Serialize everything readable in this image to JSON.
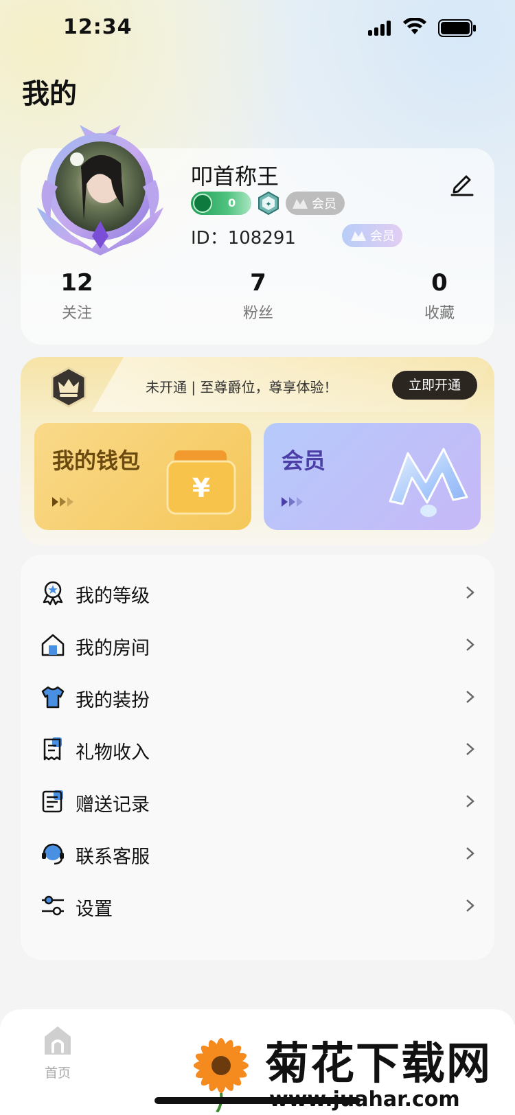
{
  "status_bar": {
    "time": "12:34"
  },
  "page": {
    "title": "我的"
  },
  "profile": {
    "nickname": "叩首称王",
    "level_value": "0",
    "vip_badge": "会员",
    "id_text": "ID：108291",
    "vip_badge_2": "会员",
    "stats": [
      {
        "value": "12",
        "label": "关注"
      },
      {
        "value": "7",
        "label": "粉丝"
      },
      {
        "value": "0",
        "label": "收藏"
      }
    ]
  },
  "vip_banner": {
    "promo_text": "未开通 | 至尊爵位，尊享体验！",
    "open_button": "立即开通"
  },
  "cards": {
    "wallet": {
      "title": "我的钱包",
      "icon_symbol": "¥"
    },
    "member": {
      "title": "会员"
    }
  },
  "menu": {
    "items": [
      {
        "label": "我的等级",
        "icon": "level-medal-icon"
      },
      {
        "label": "我的房间",
        "icon": "room-house-icon"
      },
      {
        "label": "我的装扮",
        "icon": "outfit-shirt-icon"
      },
      {
        "label": "礼物收入",
        "icon": "gift-income-receipt-icon"
      },
      {
        "label": "赠送记录",
        "icon": "gift-record-list-icon"
      },
      {
        "label": "联系客服",
        "icon": "customer-service-headset-icon"
      },
      {
        "label": "设置",
        "icon": "settings-sliders-icon"
      }
    ]
  },
  "tab_bar": {
    "home_label": "首页"
  },
  "watermark": {
    "text": "菊花下载网",
    "url": "www.juahar.com"
  },
  "colors": {
    "accent_dark": "#2b2620",
    "wallet_gold": "#f5c759",
    "member_purple": "#c6b8f7",
    "level_green": "#1f9d58"
  }
}
